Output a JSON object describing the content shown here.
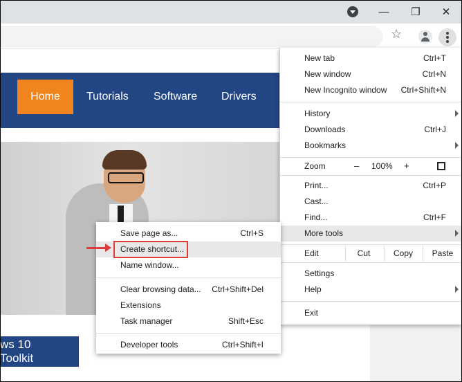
{
  "page": {
    "nav": {
      "home": "Home",
      "tutorials": "Tutorials",
      "software": "Software",
      "drivers": "Drivers"
    },
    "banner_text": "ws 10 Toolkit"
  },
  "toolbar": {
    "bookmark_icon": "star-icon",
    "profile_icon": "account-icon",
    "menu_icon": "kebab-menu-icon"
  },
  "window_controls": {
    "minimize": "—",
    "maximize": "❐",
    "close": "✕"
  },
  "menu": {
    "new_tab": {
      "label": "New tab",
      "shortcut": "Ctrl+T"
    },
    "new_window": {
      "label": "New window",
      "shortcut": "Ctrl+N"
    },
    "new_incognito": {
      "label": "New Incognito window",
      "shortcut": "Ctrl+Shift+N"
    },
    "history": {
      "label": "History"
    },
    "downloads": {
      "label": "Downloads",
      "shortcut": "Ctrl+J"
    },
    "bookmarks": {
      "label": "Bookmarks"
    },
    "zoom": {
      "label": "Zoom",
      "minus": "–",
      "value": "100%",
      "plus": "+"
    },
    "print": {
      "label": "Print...",
      "shortcut": "Ctrl+P"
    },
    "cast": {
      "label": "Cast..."
    },
    "find": {
      "label": "Find...",
      "shortcut": "Ctrl+F"
    },
    "more_tools": {
      "label": "More tools"
    },
    "edit": {
      "label": "Edit",
      "cut": "Cut",
      "copy": "Copy",
      "paste": "Paste"
    },
    "settings": {
      "label": "Settings"
    },
    "help": {
      "label": "Help"
    },
    "exit": {
      "label": "Exit"
    }
  },
  "submenu": {
    "save_page": {
      "label": "Save page as...",
      "shortcut": "Ctrl+S"
    },
    "create_shortcut": {
      "label": "Create shortcut..."
    },
    "name_window": {
      "label": "Name window..."
    },
    "clear_data": {
      "label": "Clear browsing data...",
      "shortcut": "Ctrl+Shift+Del"
    },
    "extensions": {
      "label": "Extensions"
    },
    "task_manager": {
      "label": "Task manager",
      "shortcut": "Shift+Esc"
    },
    "dev_tools": {
      "label": "Developer tools",
      "shortcut": "Ctrl+Shift+I"
    }
  },
  "colors": {
    "nav_bg": "#224583",
    "home_bg": "#f0841d",
    "highlight": "#e03a3a"
  }
}
